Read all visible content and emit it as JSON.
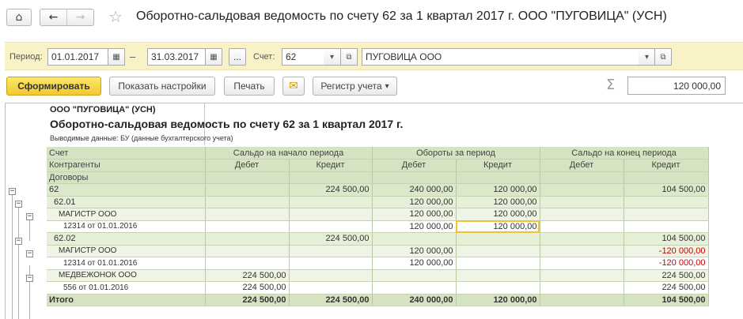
{
  "window": {
    "title": "Оборотно-сальдовая ведомость по счету 62 за 1 квартал 2017 г. ООО \"ПУГОВИЦА\" (УСН)"
  },
  "icons": {
    "home": "⌂",
    "back": "←",
    "forward": "→",
    "favorite": "☆",
    "calendar": "▦",
    "dropdown": "▾",
    "open": "⧉",
    "envelope": "✉",
    "sigma": "Σ",
    "collapse": "−"
  },
  "filters": {
    "period_label": "Период:",
    "date_from": "01.01.2017",
    "date_dash": "–",
    "date_to": "31.03.2017",
    "dots": "...",
    "account_label": "Счет:",
    "account_value": "62",
    "organization_value": "ПУГОВИЦА ООО"
  },
  "toolbar": {
    "generate": "Сформировать",
    "show_settings": "Показать настройки",
    "print": "Печать",
    "register": "Регистр учета",
    "sum_value": "120 000,00"
  },
  "report": {
    "org": "ООО \"ПУГОВИЦА\" (УСН)",
    "heading": "Оборотно-сальдовая ведомость по счету 62 за 1 квартал 2017 г.",
    "data_label": "Выводимые данные:  БУ (данные бухгалтерского учета)",
    "columns": {
      "account": "Счет",
      "counterparties": "Контрагенты",
      "contracts": "Договоры",
      "opening": "Сальдо на начало периода",
      "turnover": "Обороты за период",
      "closing": "Сальдо на конец периода",
      "debit": "Дебет",
      "credit": "Кредит"
    },
    "rows": [
      {
        "name": "62",
        "od": "",
        "oc": "224 500,00",
        "td": "240 000,00",
        "tc": "120 000,00",
        "cd": "",
        "cc": "104 500,00"
      },
      {
        "name": "62.01",
        "od": "",
        "oc": "",
        "td": "120 000,00",
        "tc": "120 000,00",
        "cd": "",
        "cc": ""
      },
      {
        "name": "МАГИСТР ООО",
        "od": "",
        "oc": "",
        "td": "120 000,00",
        "tc": "120 000,00",
        "cd": "",
        "cc": ""
      },
      {
        "name": "12314 от 01.01.2016",
        "od": "",
        "oc": "",
        "td": "120 000,00",
        "tc": "120 000,00",
        "cd": "",
        "cc": ""
      },
      {
        "name": "62.02",
        "od": "",
        "oc": "224 500,00",
        "td": "",
        "tc": "",
        "cd": "",
        "cc": "104 500,00"
      },
      {
        "name": "МАГИСТР ООО",
        "od": "",
        "oc": "",
        "td": "120 000,00",
        "tc": "",
        "cd": "",
        "cc": "-120 000,00"
      },
      {
        "name": "12314 от 01.01.2016",
        "od": "",
        "oc": "",
        "td": "120 000,00",
        "tc": "",
        "cd": "",
        "cc": "-120 000,00"
      },
      {
        "name": "МЕДВЕЖОНОК ООО",
        "od": "224 500,00",
        "oc": "",
        "td": "",
        "tc": "",
        "cd": "",
        "cc": "224 500,00"
      },
      {
        "name": "556 от 01.01.2016",
        "od": "224 500,00",
        "oc": "",
        "td": "",
        "tc": "",
        "cd": "",
        "cc": "224 500,00"
      }
    ],
    "total": {
      "name": "Итого",
      "od": "224 500,00",
      "oc": "224 500,00",
      "td": "240 000,00",
      "tc": "120 000,00",
      "cd": "",
      "cc": "104 500,00"
    }
  }
}
